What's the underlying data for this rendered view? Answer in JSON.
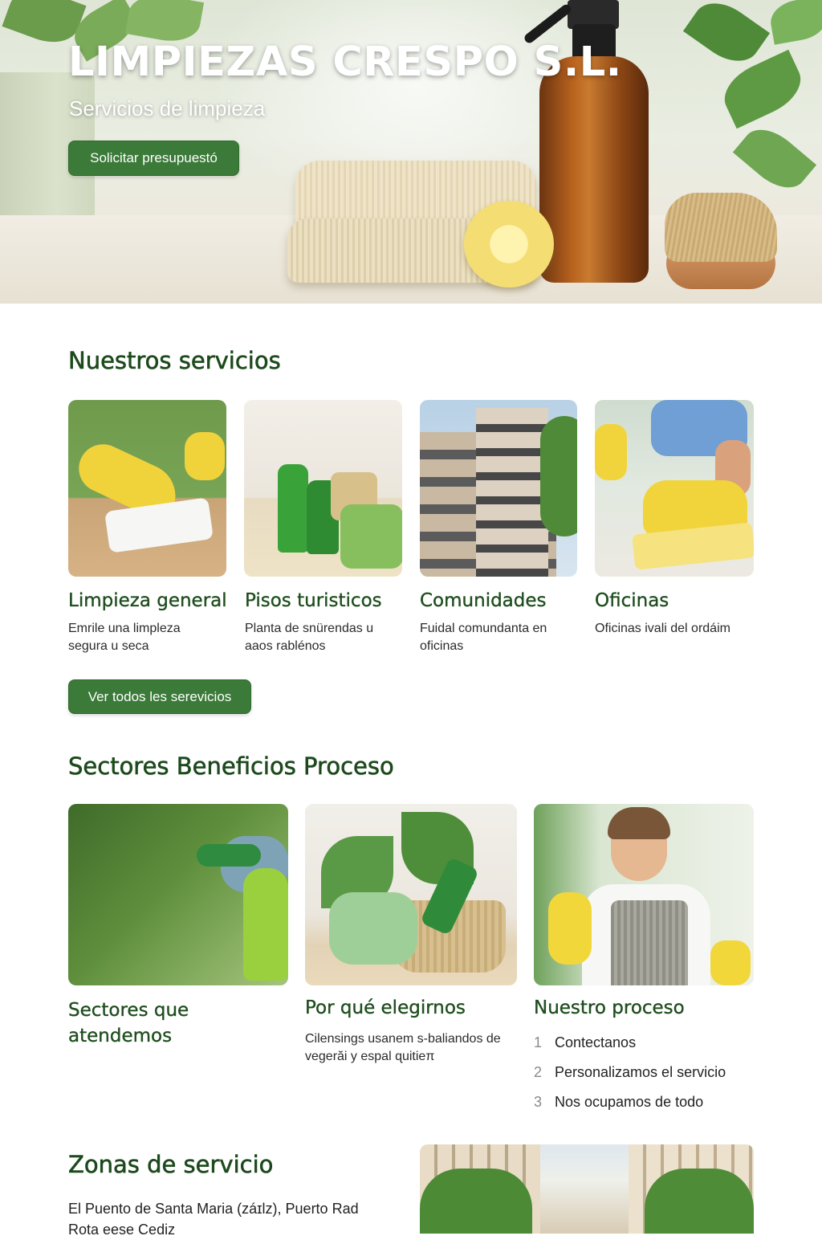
{
  "hero": {
    "title": "LIMPIEZAS CRESPO S.L.",
    "subtitle": "Servicios de limpieza",
    "cta_label": "Solicitar presupuestó"
  },
  "services": {
    "heading": "Nuestros servicios",
    "items": [
      {
        "title": "Limpieza general",
        "description": "Emrile una limpleza segura u seca"
      },
      {
        "title": "Pisos turisticos",
        "description": "Planta de snürendas u aaos rablénos"
      },
      {
        "title": "Comunidades",
        "description": "Fuidal comundanta en oficinas"
      },
      {
        "title": "Oficinas",
        "description": "Oficinas  ivali del ordáim"
      }
    ],
    "all_label": "Ver todos les serevicios"
  },
  "sectors": {
    "heading": "Sectores  Beneficios  Proceso",
    "cards": [
      {
        "title": "Sectores que atendemos",
        "description": ""
      },
      {
        "title": "Por qué elegirnos",
        "description": "Cilensings usanem s-baliandos de vegerăi y espal ɋuitieπ"
      },
      {
        "title": "Nuestro proceso",
        "description": ""
      }
    ],
    "steps": [
      {
        "num": "1",
        "label": "Contectanos"
      },
      {
        "num": "2",
        "label": "Personalizamos el servicio"
      },
      {
        "num": "3",
        "label": "Nos ocupamos de todo"
      }
    ]
  },
  "zones": {
    "heading": "Zonas de servicio",
    "text": "El Puento de Santa Maria (záɪlz), Puerto Rad  Rota  eese  Cediz"
  },
  "colors": {
    "brand_green": "#3b7a38",
    "heading_green": "#1d4a1c",
    "background": "#ffffff"
  }
}
